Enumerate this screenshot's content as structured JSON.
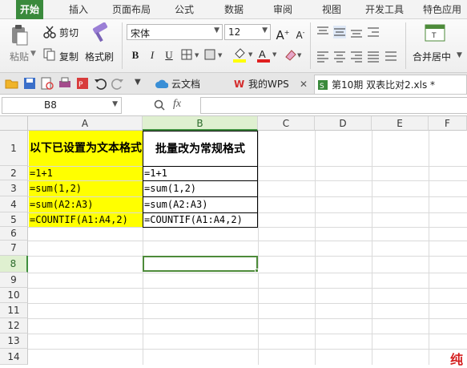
{
  "menu": {
    "tabs": [
      "开始",
      "插入",
      "页面布局",
      "公式",
      "数据",
      "审阅",
      "视图",
      "开发工具",
      "特色应用"
    ]
  },
  "ribbon": {
    "paste_label": "粘贴",
    "cut_label": "剪切",
    "copy_label": "复制",
    "format_painter_label": "格式刷",
    "font_name": "宋体",
    "font_size": "12",
    "bold": "B",
    "italic": "I",
    "underline": "U",
    "merge_center_label": "合并居中"
  },
  "quickbar": {
    "doc_tabs": [
      "云文档",
      "我的WPS",
      "第10期 双表比对2.xls *"
    ]
  },
  "formula_bar": {
    "name_box": "B8",
    "fx_label": "fx",
    "formula_value": ""
  },
  "sheet": {
    "columns": [
      "A",
      "B",
      "C",
      "D",
      "E",
      "F"
    ],
    "rows": [
      "1",
      "2",
      "3",
      "4",
      "5",
      "6",
      "7",
      "8",
      "9",
      "10",
      "11",
      "12",
      "13",
      "14"
    ],
    "selected_cell": "B8",
    "header_a": "以下已设置为文本格式",
    "header_b": "批量改为常规格式",
    "cells_a": [
      "=1+1",
      "=sum(1,2)",
      "=sum(A2:A3)",
      "=COUNTIF(A1:A4,2)"
    ],
    "cells_b": [
      "=1+1",
      "=sum(1,2)",
      "=sum(A2:A3)",
      "=COUNTIF(A1:A4,2)"
    ]
  },
  "watermark": "纯",
  "colors": {
    "active_tab": "#3a8a3c",
    "highlight_fill": "#ffff00",
    "selection": "#4d8b3a"
  }
}
